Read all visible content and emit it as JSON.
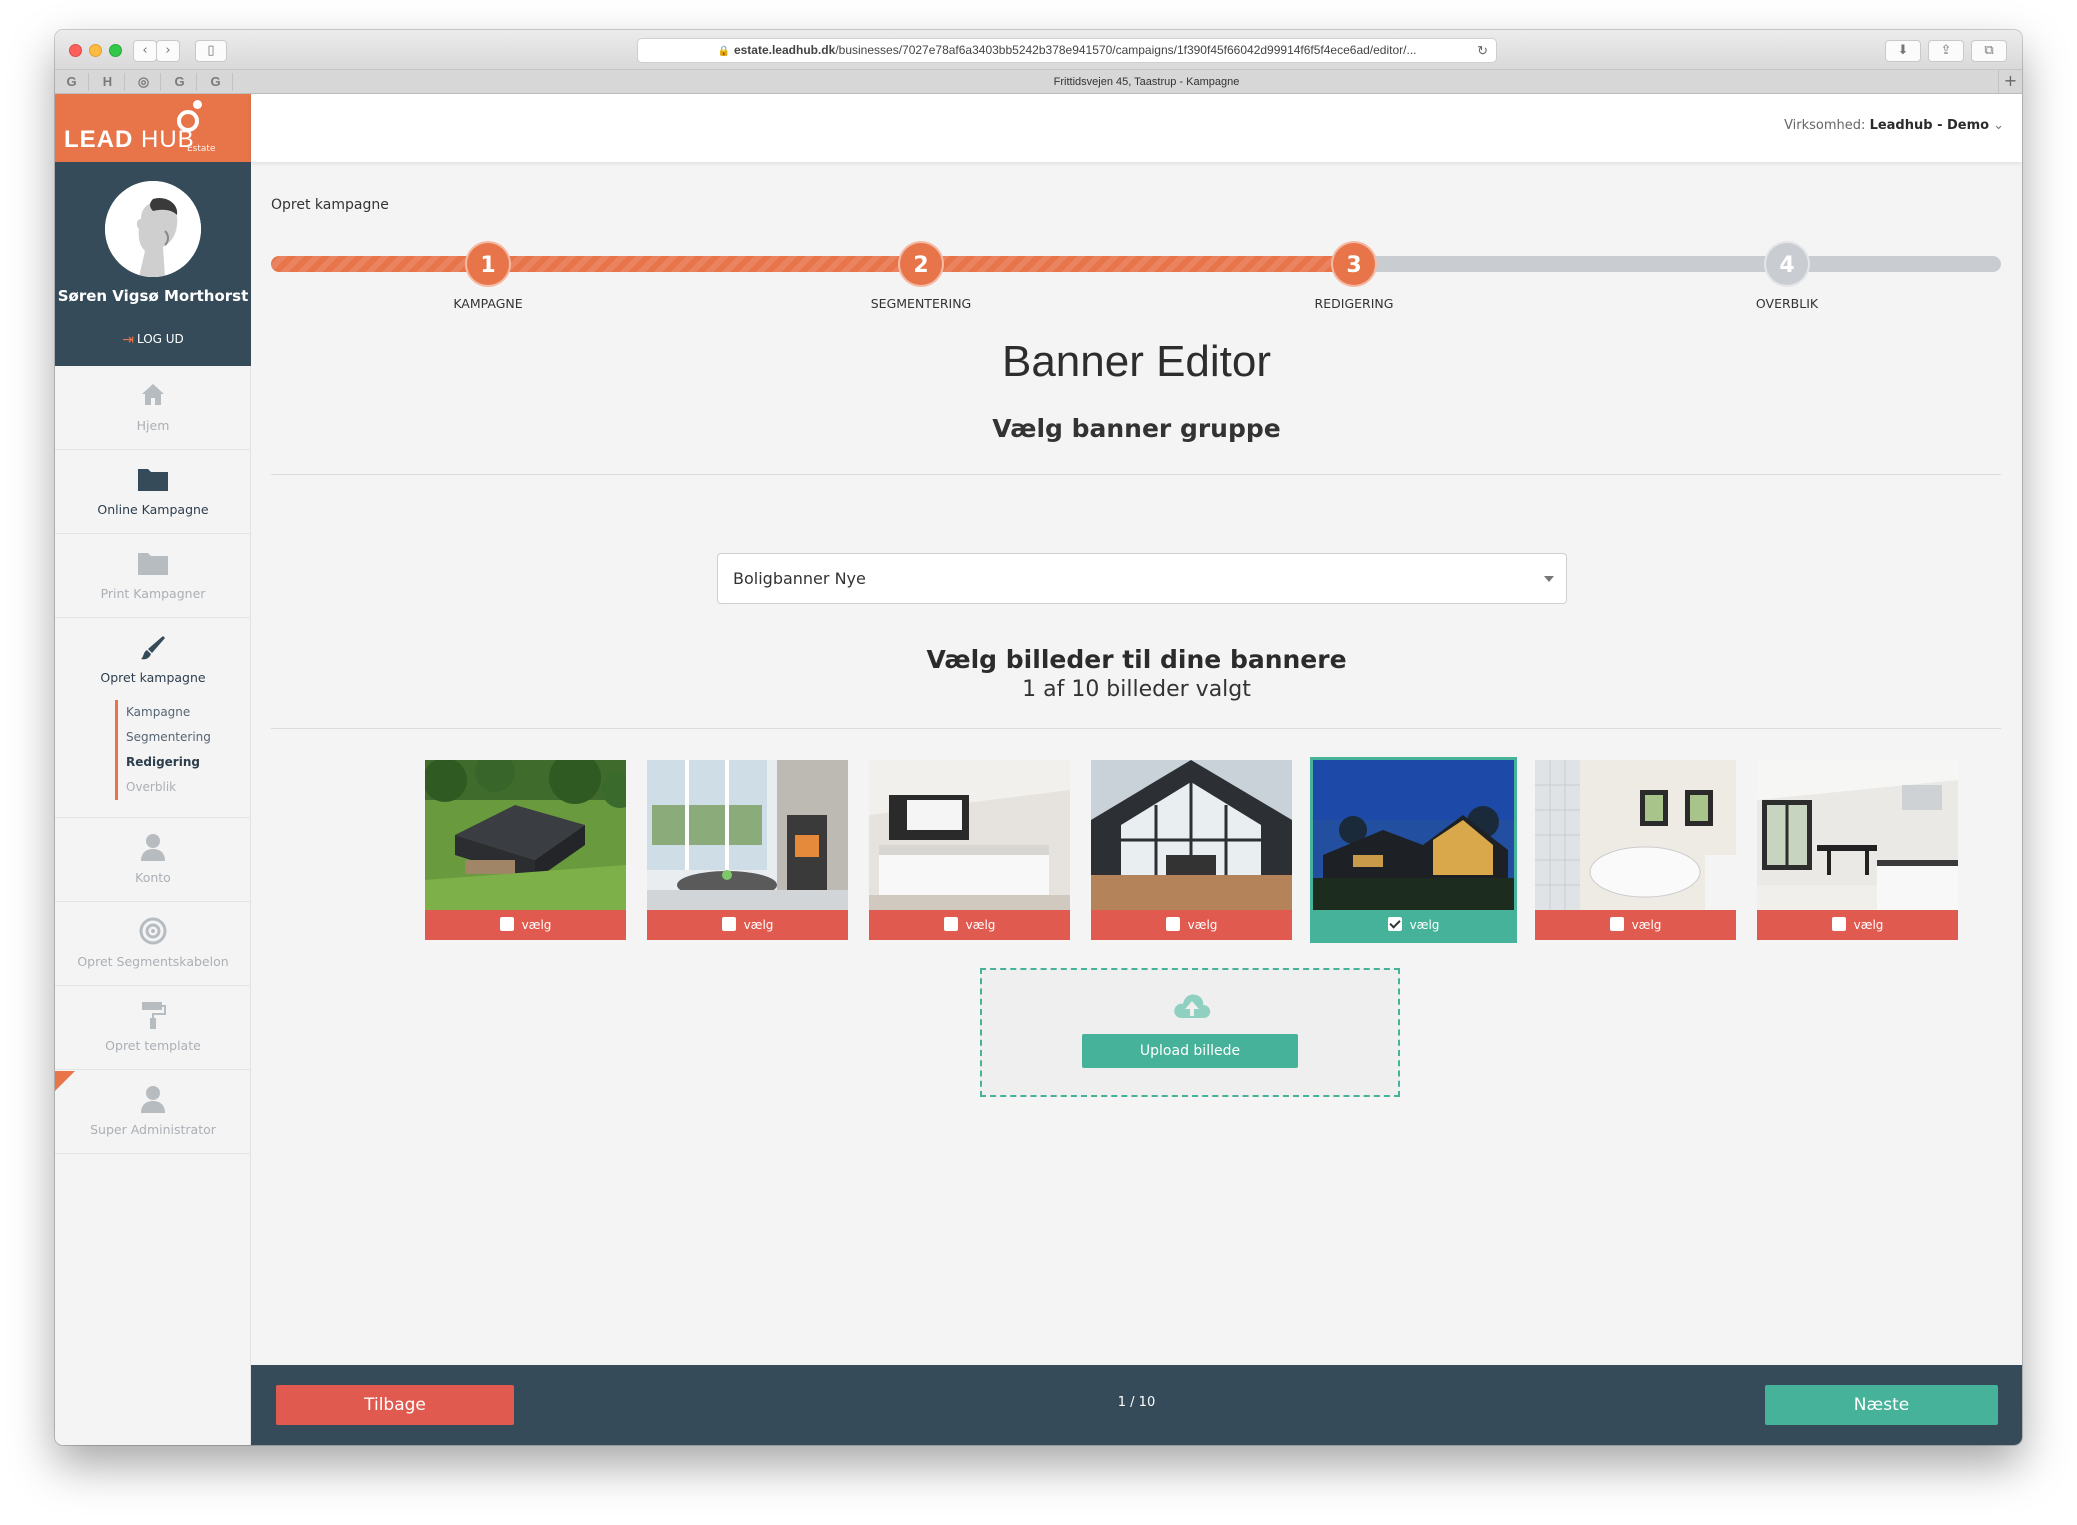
{
  "browser": {
    "url_domain": "estate.leadhub.dk",
    "url_path": "/businesses/7027e78af6a3403bb5242b378e941570/campaigns/1f390f45f66042d99914f6f5f4ece6ad/editor/...",
    "tab_title": "Frittidsvejen 45, Taastrup - Kampagne",
    "favicons": [
      "G",
      "H",
      "◎",
      "G",
      "G"
    ]
  },
  "logo": {
    "bold": "LEAD",
    "light": "HUB",
    "sub": "Estate"
  },
  "user": {
    "name": "Søren Vigsø Morthorst",
    "logout": "LOG UD"
  },
  "sidebar": {
    "items": [
      {
        "label": "Hjem",
        "icon": "home-icon"
      },
      {
        "label": "Online Kampagne",
        "icon": "folder-icon"
      },
      {
        "label": "Print Kampagner",
        "icon": "folder-icon"
      },
      {
        "label": "Opret kampagne",
        "icon": "brush-icon"
      },
      {
        "label": "Konto",
        "icon": "user-icon"
      },
      {
        "label": "Opret Segmentskabelon",
        "icon": "target-icon"
      },
      {
        "label": "Opret template",
        "icon": "paint-roller-icon"
      },
      {
        "label": "Super Administrator",
        "icon": "user-icon"
      }
    ],
    "subitems": [
      "Kampagne",
      "Segmentering",
      "Redigering",
      "Overblik"
    ]
  },
  "topbar": {
    "company_label": "Virksomhed:",
    "company_name": "Leadhub - Demo"
  },
  "wizard": {
    "breadcrumb": "Opret kampagne",
    "steps": [
      {
        "num": "1",
        "label": "KAMPAGNE"
      },
      {
        "num": "2",
        "label": "SEGMENTERING"
      },
      {
        "num": "3",
        "label": "REDIGERING"
      },
      {
        "num": "4",
        "label": "OVERBLIK"
      }
    ],
    "current_step": 3
  },
  "editor": {
    "title": "Banner Editor",
    "group_heading": "Vælg banner gruppe",
    "group_selected": "Boligbanner Nye",
    "images_heading": "Vælg billeder til dine bannere",
    "images_count": "1 af 10 billeder valgt",
    "images": [
      {
        "label": "vælg",
        "selected": false,
        "scene": "aerial-house-garden"
      },
      {
        "label": "vælg",
        "selected": false,
        "scene": "living-room-fireplace"
      },
      {
        "label": "vælg",
        "selected": false,
        "scene": "bedroom"
      },
      {
        "label": "vælg",
        "selected": false,
        "scene": "terrace-facade"
      },
      {
        "label": "vælg",
        "selected": true,
        "scene": "house-at-dusk"
      },
      {
        "label": "vælg",
        "selected": false,
        "scene": "bathroom-spa"
      },
      {
        "label": "vælg",
        "selected": false,
        "scene": "kitchen-dining"
      }
    ],
    "upload_label": "Upload billede"
  },
  "footer": {
    "back": "Tilbage",
    "pager": "1 / 10",
    "next": "Næste"
  },
  "colors": {
    "accent": "#e8754a",
    "danger": "#e05a4f",
    "success": "#46b29a",
    "navy": "#364b5a"
  }
}
